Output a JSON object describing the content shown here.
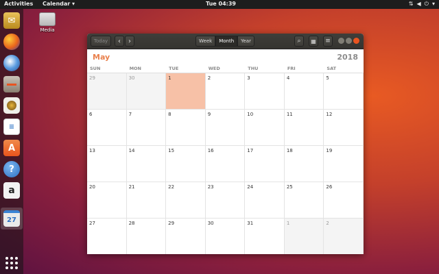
{
  "topbar": {
    "activities": "Activities",
    "app_menu": "Calendar ▾",
    "clock": "Tue 04:39",
    "tray_icons": [
      "network-icon",
      "volume-icon",
      "power-icon",
      "chevron-down-icon"
    ]
  },
  "desktop": {
    "media_label": "Media"
  },
  "dock": {
    "items": [
      {
        "name": "files-manager-icon",
        "color": "#c9a227"
      },
      {
        "name": "firefox-icon",
        "color": "#e8641c"
      },
      {
        "name": "thunderbird-icon",
        "color": "#2f6db5"
      },
      {
        "name": "files-icon",
        "color": "#8a7f71"
      },
      {
        "name": "rhythmbox-icon",
        "color": "#e8b53a"
      },
      {
        "name": "libreoffice-writer-icon",
        "color": "#3b7bc8"
      },
      {
        "name": "software-center-icon",
        "color": "#e8641c"
      },
      {
        "name": "help-icon",
        "color": "#3a83d4"
      },
      {
        "name": "amazon-icon",
        "color": "#f2f2f2"
      },
      {
        "name": "calendar-icon",
        "color": "#eaeaea"
      }
    ],
    "calendar_day": "27"
  },
  "header": {
    "today": "Today",
    "prev": "‹",
    "next": "›",
    "views": [
      "Week",
      "Month",
      "Year"
    ],
    "active_view": "Month",
    "search": "⌕",
    "add": "▦",
    "menu": "≡"
  },
  "calendar": {
    "month": "May",
    "year": "2018",
    "weekdays": [
      "SUN",
      "MON",
      "TUE",
      "WED",
      "THU",
      "FRI",
      "SAT"
    ],
    "weeks": [
      [
        {
          "d": "29",
          "other": true
        },
        {
          "d": "30",
          "other": true
        },
        {
          "d": "1",
          "today": true
        },
        {
          "d": "2"
        },
        {
          "d": "3"
        },
        {
          "d": "4"
        },
        {
          "d": "5"
        }
      ],
      [
        {
          "d": "6"
        },
        {
          "d": "7"
        },
        {
          "d": "8"
        },
        {
          "d": "9"
        },
        {
          "d": "10"
        },
        {
          "d": "11"
        },
        {
          "d": "12"
        }
      ],
      [
        {
          "d": "13"
        },
        {
          "d": "14"
        },
        {
          "d": "15"
        },
        {
          "d": "16"
        },
        {
          "d": "17"
        },
        {
          "d": "18"
        },
        {
          "d": "19"
        }
      ],
      [
        {
          "d": "20"
        },
        {
          "d": "21"
        },
        {
          "d": "22"
        },
        {
          "d": "23"
        },
        {
          "d": "24"
        },
        {
          "d": "25"
        },
        {
          "d": "26"
        }
      ],
      [
        {
          "d": "27"
        },
        {
          "d": "28"
        },
        {
          "d": "29"
        },
        {
          "d": "30"
        },
        {
          "d": "31"
        },
        {
          "d": "1",
          "other": true
        },
        {
          "d": "2",
          "other": true
        }
      ]
    ]
  }
}
